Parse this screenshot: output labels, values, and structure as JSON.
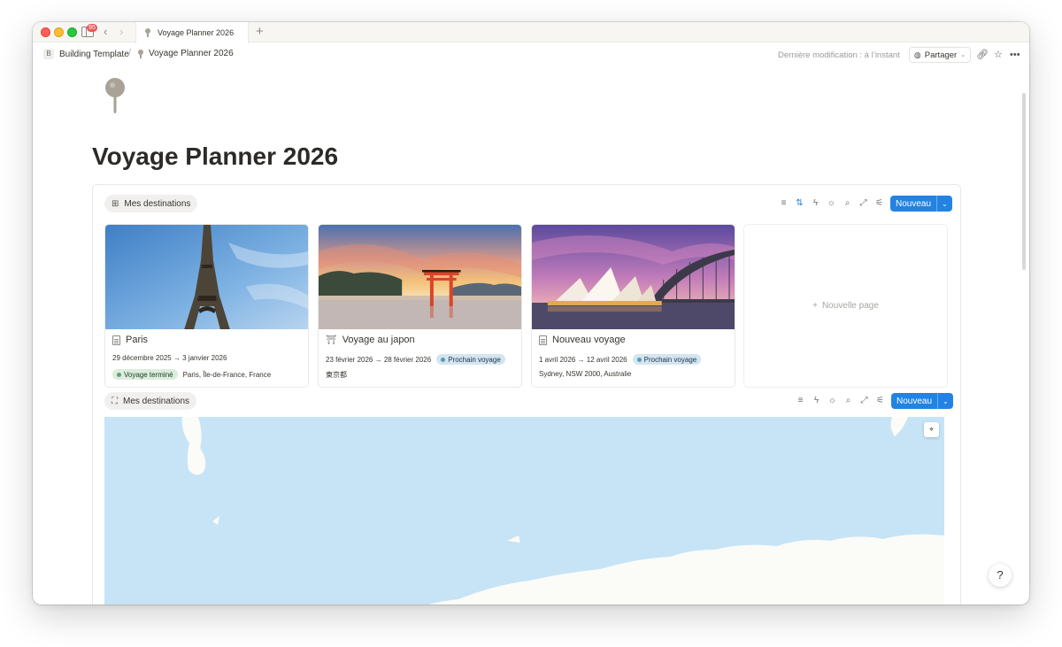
{
  "tabbar": {
    "badge_count": "95",
    "tab_title": "Voyage Planner 2026",
    "new_tab": "+"
  },
  "breadcrumb": {
    "workspace_initial": "B",
    "workspace": "Building Template",
    "separator": "/",
    "page": "Voyage Planner 2026"
  },
  "topbar": {
    "last_modified": "Dernière modification : à l’instant",
    "share_label": "Partager"
  },
  "page": {
    "title": "Voyage Planner 2026"
  },
  "gallery_view": {
    "view_name": "Mes destinations",
    "view_icon": "gallery-icon",
    "new_label": "Nouveau",
    "cards": [
      {
        "title": "Paris",
        "dates": "29 décembre 2025 → 3 janvier 2026",
        "status": "Voyage terminé",
        "location": "Paris, Île-de-France, France"
      },
      {
        "title": "Voyage au japon",
        "dates": "23 février 2026 → 28 février 2026",
        "status": "Prochain voyage",
        "location": "東京都"
      },
      {
        "title": "Nouveau voyage",
        "dates": "1 avril 2026 → 12 avril 2026",
        "status": "Prochain voyage",
        "location": "Sydney, NSW 2000, Australie"
      }
    ],
    "new_page_label": "Nouvelle page"
  },
  "map_view": {
    "view_name": "Mes destinations",
    "view_icon": "map-icon",
    "new_label": "Nouveau"
  },
  "colors": {
    "accent": "#2383e2",
    "tag_green": "#dbeddb",
    "tag_blue": "#d3e5ef",
    "map_water": "#c6e4f6"
  }
}
